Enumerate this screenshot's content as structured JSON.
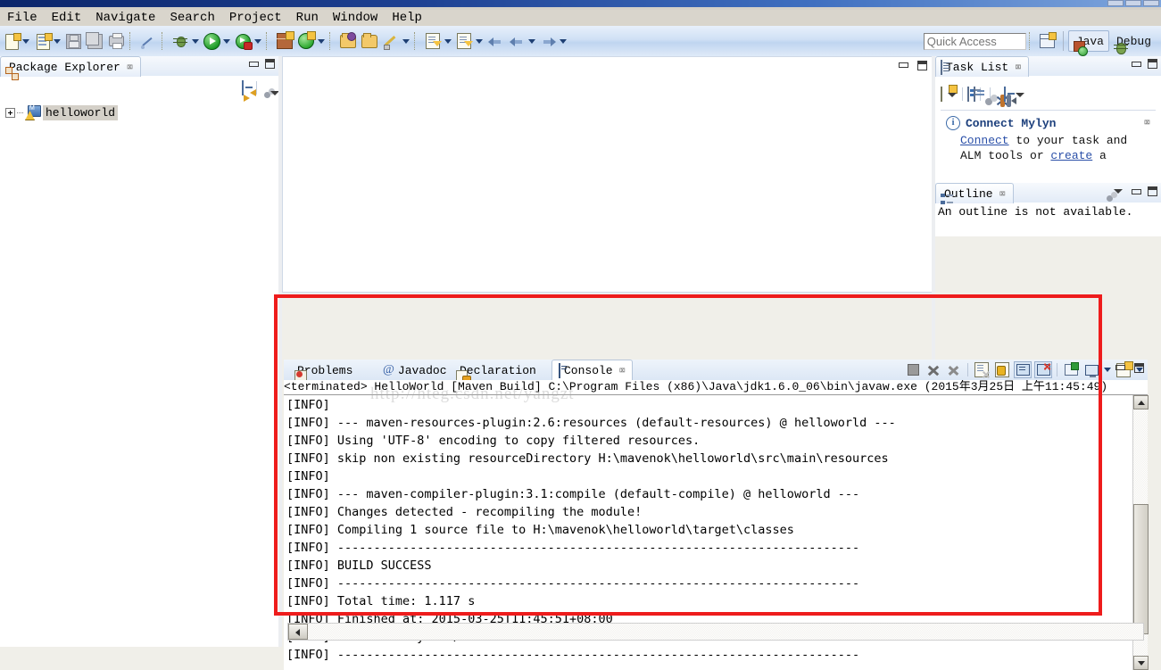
{
  "window": {
    "title_bar_visible": true
  },
  "menubar": {
    "items": [
      {
        "label": "File"
      },
      {
        "label": "Edit"
      },
      {
        "label": "Navigate"
      },
      {
        "label": "Search"
      },
      {
        "label": "Project"
      },
      {
        "label": "Run"
      },
      {
        "label": "Window"
      },
      {
        "label": "Help"
      }
    ]
  },
  "toolbar": {
    "icons": [
      "new-wizard-icon",
      "new-java-file-icon",
      "save-icon",
      "save-all-icon",
      "print-icon",
      "toggle-mark-occurrences-icon",
      "debug-icon",
      "run-icon",
      "run-coverage-icon",
      "new-package-icon",
      "new-annotation-icon",
      "open-type-icon",
      "open-task-icon",
      "brush-icon",
      "next-annotation-icon",
      "previous-annotation-icon",
      "back-icon",
      "forward-icon"
    ],
    "quick_access": {
      "placeholder": "Quick Access",
      "value": ""
    },
    "open_perspective_label": "",
    "perspectives": [
      {
        "label": "Java",
        "active": true,
        "icon": "java-perspective-icon"
      },
      {
        "label": "Debug",
        "active": false,
        "icon": "debug-perspective-icon"
      }
    ]
  },
  "package_explorer": {
    "tab_title": "Package Explorer",
    "tab_close": "⌧",
    "toolbar_icons": [
      "collapse-all-icon",
      "link-with-editor-icon",
      "focus-on-active-task-icon",
      "view-menu-icon"
    ],
    "tree": [
      {
        "label": "helloworld",
        "icon": "maven-project-icon",
        "expanded": false,
        "selected": true
      }
    ]
  },
  "editor_area": {
    "empty": true
  },
  "task_list": {
    "tab_title": "Task List",
    "tab_close": "⌧",
    "toolbar_icons": [
      "new-task-icon",
      "new-task-dropdown-icon",
      "categorized-presentation-icon",
      "scheduled-presentation-icon",
      "focus-on-workweek-icon",
      "collapse-all-icon",
      "synchronize-icon",
      "minimize-icon",
      "restore-icon",
      "view-menu-icon"
    ],
    "notice": {
      "icon": "info-icon",
      "title": "Connect Mylyn",
      "close": "⌧",
      "text_parts": [
        {
          "text": "Connect",
          "link": true
        },
        {
          "text": " to your task and",
          "link": false
        },
        {
          "text": "ALM tools or ",
          "link": false
        },
        {
          "text": "create",
          "link": true
        },
        {
          "text": " a",
          "link": false
        }
      ],
      "line1": "Connect to your task and",
      "line2": "ALM tools or create a"
    }
  },
  "outline": {
    "tab_title": "Outline",
    "tab_close": "⌧",
    "message": "An outline is not available.",
    "toolbar_icons": [
      "focus-icon",
      "view-menu-icon",
      "minimize-icon",
      "restore-icon"
    ]
  },
  "console_panel": {
    "tabs": [
      {
        "label": "Problems",
        "icon": "problems-icon",
        "active": false
      },
      {
        "label": "Javadoc",
        "icon": "javadoc-icon",
        "active": false
      },
      {
        "label": "Declaration",
        "icon": "declaration-icon",
        "active": false
      },
      {
        "label": "Console",
        "icon": "console-icon",
        "active": true,
        "close": "⌧"
      }
    ],
    "toolbar_icons": [
      "terminate-icon",
      "remove-launch-icon",
      "remove-all-terminated-icon",
      "clear-console-icon",
      "scroll-lock-icon",
      "show-console-on-output-icon",
      "show-console-on-error-icon",
      "pin-console-icon",
      "display-selected-console-icon",
      "display-console-dropdown-icon",
      "open-console-icon",
      "open-console-dropdown-icon"
    ],
    "process_header": "<terminated> HelloWorld [Maven Build] C:\\Program Files (x86)\\Java\\jdk1.6.0_06\\bin\\javaw.exe (2015年3月25日 上午11:45:49)",
    "output_lines": [
      "[INFO]",
      "[INFO] --- maven-resources-plugin:2.6:resources (default-resources) @ helloworld ---",
      "[INFO] Using 'UTF-8' encoding to copy filtered resources.",
      "[INFO] skip non existing resourceDirectory H:\\mavenok\\helloworld\\src\\main\\resources",
      "[INFO]",
      "[INFO] --- maven-compiler-plugin:3.1:compile (default-compile) @ helloworld ---",
      "[INFO] Changes detected - recompiling the module!",
      "[INFO] Compiling 1 source file to H:\\mavenok\\helloworld\\target\\classes",
      "[INFO] ------------------------------------------------------------------------",
      "[INFO] BUILD SUCCESS",
      "[INFO] ------------------------------------------------------------------------",
      "[INFO] Total time: 1.117 s",
      "[INFO] Finished at: 2015-03-25T11:45:51+08:00",
      "[INFO] Final Memory: 6M/12M",
      "[INFO] ------------------------------------------------------------------------"
    ]
  },
  "watermark": {
    "text": "http://hteg.csdn.net/yangzt"
  },
  "annotations": {
    "highlight_color": "#ee1c1c"
  }
}
